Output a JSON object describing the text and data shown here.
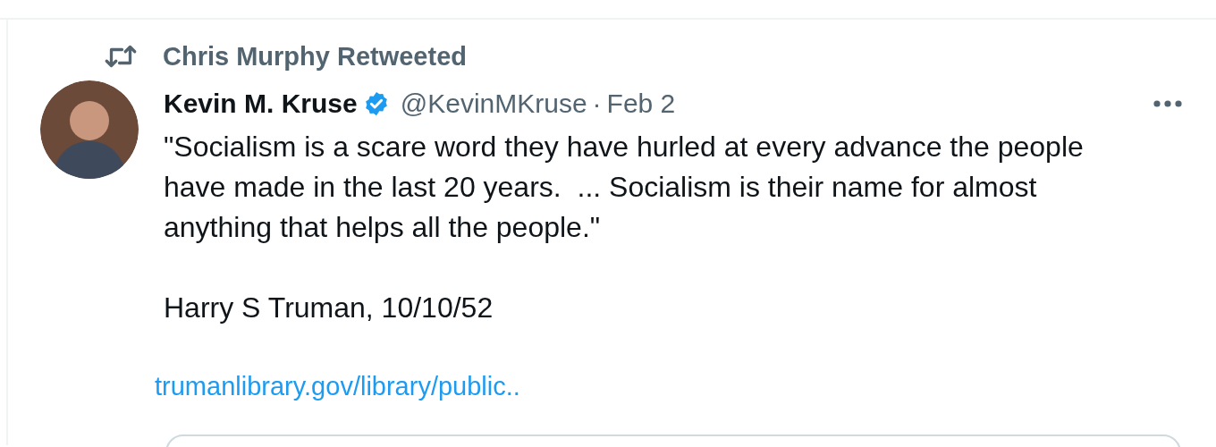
{
  "retweet": {
    "label": "Chris Murphy Retweeted"
  },
  "tweet": {
    "author": "Kevin M. Kruse",
    "verified": true,
    "handle": "@KevinMKruse",
    "separator": "·",
    "date": "Feb 2",
    "paragraphs": [
      "\"Socialism is a scare word they have hurled at every advance the people have made in the last 20 years.  ... Socialism is their name for almost anything that helps all the people.\"",
      "Harry S Truman, 10/10/52"
    ],
    "link": "trumanlibrary.gov/library/public.."
  }
}
